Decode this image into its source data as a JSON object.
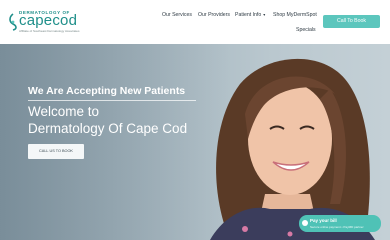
{
  "header": {
    "logo": {
      "top": "DERMATOLOGY OF",
      "main": "capecod",
      "sub": "Affiliate of Southeast Dermatology Associates"
    },
    "nav": {
      "services": "Our Services",
      "providers": "Our Providers",
      "patient_info": "Patient Info",
      "shop": "Shop MyDermSpot",
      "specials": "Specials"
    },
    "cta_label": "Call To Book"
  },
  "hero": {
    "eyebrow": "We Are Accepting New Patients",
    "headline_line1": "Welcome to",
    "headline_line2": "Dermatology Of Cape Cod",
    "button_label": "CALL US TO BOOK"
  },
  "pay_widget": {
    "title": "Pay your bill",
    "subtitle": "Secure online payment • PayMD partner"
  },
  "colors": {
    "brand_teal": "#1f8f8a",
    "accent": "#5cc6bd",
    "pay_bg": "#4fc2b6"
  },
  "icons": {
    "logo_mark": "leaf-swirl-icon",
    "caret": "chevron-down-icon",
    "pay": "chat-bubble-icon"
  }
}
